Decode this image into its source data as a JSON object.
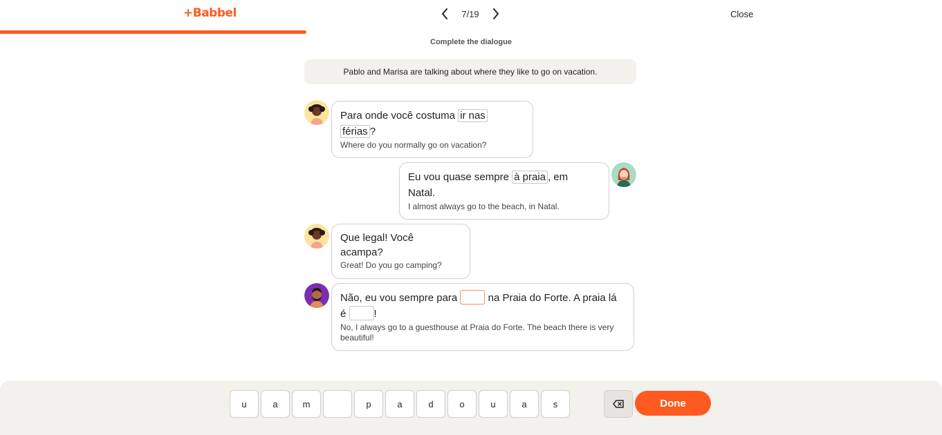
{
  "app": {
    "logo": "+Babbel"
  },
  "header": {
    "page_counter": "7/19",
    "close_label": "Close",
    "progress": 0.368
  },
  "exercise": {
    "instruction": "Complete the dialogue",
    "context": "Pablo and Marisa are talking about where they like to go on vacation."
  },
  "messages": [
    {
      "pt_before": "Para onde você costuma ",
      "pt_highlight_1": "ir nas",
      "pt_highlight_2": "férias",
      "pt_after": "?",
      "en": "Where do you normally go on vacation?"
    },
    {
      "pt_before": "Eu vou quase sempre ",
      "pt_highlight": "à praia",
      "pt_after": ", em Natal.",
      "en": "I almost always go to the beach, in Natal."
    },
    {
      "pt": "Que legal! Você acampa?",
      "en": "Great! Do you go camping?"
    },
    {
      "pt_part1": "Não, eu vou sempre para ",
      "pt_part2": " na Praia do Forte. A praia lá é ",
      "pt_part3": "!",
      "en": "No, I always go to a guesthouse at Praia do Forte. The beach there is very beautiful!"
    }
  ],
  "keyboard": {
    "keys": [
      "u",
      "a",
      "m",
      "",
      "p",
      "a",
      "d",
      "o",
      "u",
      "a",
      "s"
    ],
    "done_label": "Done"
  },
  "colors": {
    "accent": "#ff5a1f",
    "panel": "#f2f1ec"
  }
}
